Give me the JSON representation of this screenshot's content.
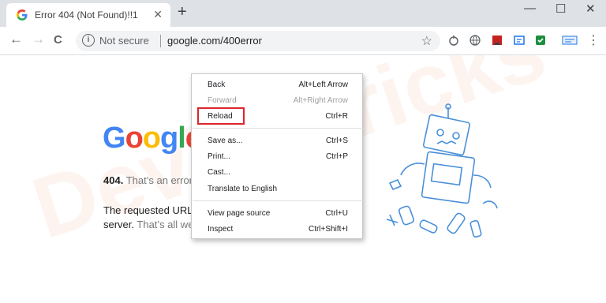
{
  "tab": {
    "title": "Error 404 (Not Found)!!1",
    "close": "✕"
  },
  "newtab_symbol": "+",
  "window_controls": {
    "minimize": "—",
    "maximize": "☐",
    "close": "✕"
  },
  "toolbar": {
    "back": "←",
    "forward": "→",
    "reload": "C"
  },
  "omnibox": {
    "info": "i",
    "security": "Not secure",
    "url": "google.com/400error",
    "star": "☆"
  },
  "extensions": [
    "extension-1",
    "extension-2",
    "extension-3",
    "extension-4",
    "extension-5",
    "extension-6"
  ],
  "menu_icon": "⋮",
  "page": {
    "logo": {
      "g1": "G",
      "o1": "o",
      "o2": "o",
      "g2": "g",
      "l": "l",
      "e": "e"
    },
    "error_code": "404.",
    "error_short": "That’s an error",
    "message_line1": "The requested URL",
    "message_line2_a": "server.",
    "message_line2_b": "That’s all we"
  },
  "context_menu": {
    "items": [
      {
        "label": "Back",
        "shortcut": "Alt+Left Arrow"
      },
      {
        "label": "Forward",
        "shortcut": "Alt+Right Arrow"
      },
      {
        "label": "Reload",
        "shortcut": "Ctrl+R"
      },
      {
        "label": "Save as...",
        "shortcut": "Ctrl+S"
      },
      {
        "label": "Print...",
        "shortcut": "Ctrl+P"
      },
      {
        "label": "Cast...",
        "shortcut": ""
      },
      {
        "label": "Translate to English",
        "shortcut": ""
      },
      {
        "label": "View page source",
        "shortcut": "Ctrl+U"
      },
      {
        "label": "Inspect",
        "shortcut": "Ctrl+Shift+I"
      }
    ]
  },
  "colors": {
    "highlight": "#d9262c",
    "google_blue": "#4285f4",
    "google_red": "#ea4335",
    "google_yellow": "#fbbc05",
    "google_green": "#34a853"
  }
}
